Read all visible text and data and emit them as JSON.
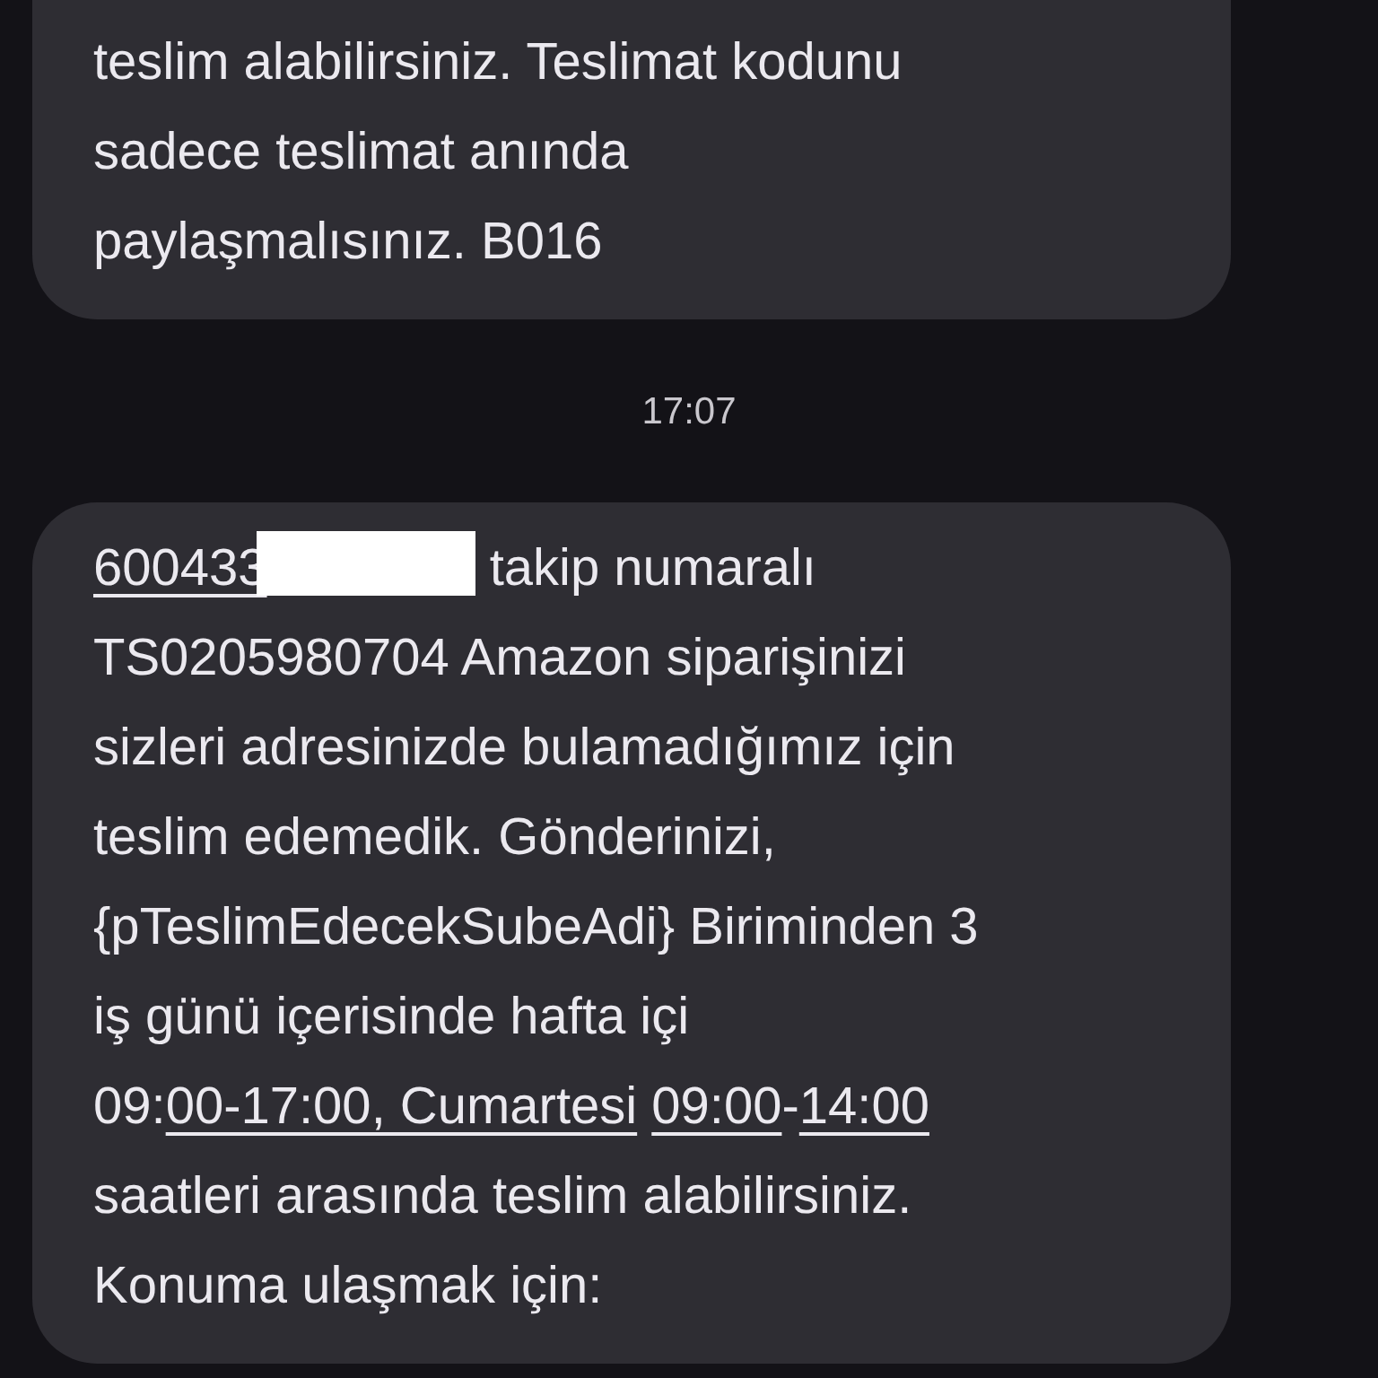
{
  "messages": [
    {
      "kind": "bubble",
      "segments": [
        {
          "kind": "text",
          "text": "teslim alabilirsiniz. Teslimat kodunu\nsadece teslimat anında\npaylaşmalısınız. B016"
        }
      ]
    },
    {
      "kind": "time",
      "text": "17:07"
    },
    {
      "kind": "bubble",
      "segments": [
        {
          "kind": "link",
          "text": "600433"
        },
        {
          "kind": "redacted"
        },
        {
          "kind": "text",
          "text": " takip numaralı\nTS0205980704 Amazon siparişinizi\nsizleri adresinizde bulamadığımız için\nteslim edemedik. Gönderinizi,\n{pTeslimEdecekSubeAdi} Biriminden 3\niş günü içerisinde hafta içi\n09:"
        },
        {
          "kind": "link",
          "text": "00-17:00, Cumartesi"
        },
        {
          "kind": "space"
        },
        {
          "kind": "link",
          "text": "09:00"
        },
        {
          "kind": "text",
          "text": "-"
        },
        {
          "kind": "link",
          "text": "14:00"
        },
        {
          "kind": "text",
          "text": "\nsaatleri arasında teslim alabilirsiniz.\nKonuma ulaşmak için:"
        }
      ]
    }
  ]
}
